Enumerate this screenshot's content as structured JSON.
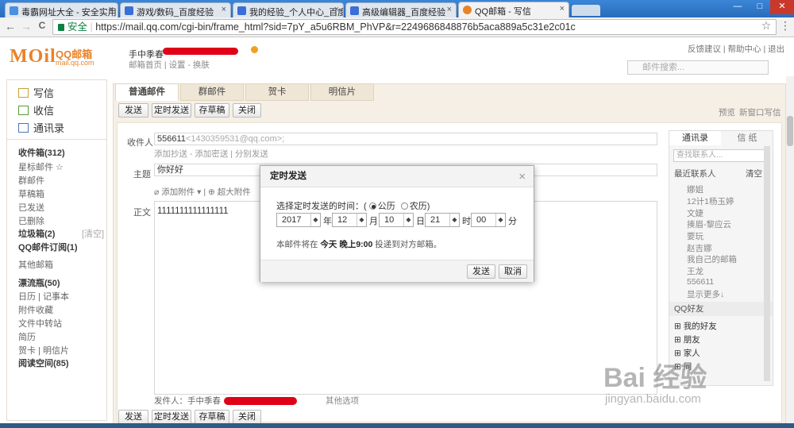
{
  "browser": {
    "tabs": [
      {
        "label": "毒霸网址大全 - 安全实用",
        "fav": "#4a8fe0"
      },
      {
        "label": "游戏/数码_百度经验",
        "fav": "#3b6fd8"
      },
      {
        "label": "我的经验_个人中心_百度",
        "fav": "#3b6fd8"
      },
      {
        "label": "高级编辑器_百度经验",
        "fav": "#3b6fd8"
      },
      {
        "label": "QQ邮箱 - 写信",
        "fav": "#e8832a"
      }
    ],
    "secure_label": "安全",
    "url": "https://mail.qq.com/cgi-bin/frame_html?sid=7pY_a5u6RBM_PhVP&r=2249686848876b5aca889a5c31e2c01c",
    "tab_close": "×",
    "minimize": "—",
    "maximize": "□",
    "close": "✕",
    "back": "←",
    "forward": "→",
    "reload": "C",
    "star": "☆",
    "menu": "⋮"
  },
  "mail": {
    "logo_mark": "MOil",
    "logo_title": "QQ邮箱",
    "logo_domain": "mail.qq.com",
    "user_name": "手中季春",
    "home_link": "邮箱首页",
    "settings_link": "设置",
    "skin_link": "换肤",
    "top_links": [
      "反馈建议",
      "帮助中心",
      "退出"
    ],
    "search_placeholder": "邮件搜索..."
  },
  "sidebar": {
    "write": "写信",
    "inbox": "收信",
    "contacts": "通讯录",
    "folders": [
      {
        "label": "收件箱(312)",
        "bold": true
      },
      {
        "label": "星标邮件 ☆",
        "bold": false
      },
      {
        "label": "群邮件",
        "bold": false
      },
      {
        "label": "草稿箱",
        "bold": false
      },
      {
        "label": "已发送",
        "bold": false
      },
      {
        "label": "已删除",
        "bold": false
      },
      {
        "label": "垃圾箱(2)",
        "bold": true
      },
      {
        "label": "QQ邮件订阅(1)",
        "bold": true
      },
      {
        "label": "其他邮箱",
        "bold": false
      },
      {
        "label": "漂流瓶(50)",
        "bold": true
      },
      {
        "label": "日历 | 记事本",
        "bold": false
      },
      {
        "label": "附件收藏",
        "bold": false
      },
      {
        "label": "文件中转站",
        "bold": false
      },
      {
        "label": "简历",
        "bold": false
      },
      {
        "label": "贺卡 | 明信片",
        "bold": false
      },
      {
        "label": "阅读空间(85)",
        "bold": true
      }
    ],
    "clear": "[清空]"
  },
  "compose": {
    "tabs": [
      "普通邮件",
      "群邮件",
      "贺卡",
      "明信片"
    ],
    "buttons": [
      "发送",
      "定时发送",
      "存草稿",
      "关闭"
    ],
    "preview": "预览",
    "new_window": "新窗口写信",
    "to_label": "收件人",
    "to_value": "556611",
    "to_email": "<1430359531@qq.com>;",
    "cc_links": [
      "添加抄送",
      "添加密送",
      "分别发送"
    ],
    "subject_label": "主题",
    "subject_value": "你好好",
    "attach": "添加附件",
    "big_attach": "超大附件",
    "body_label": "正文",
    "body_value": "1111111111111111",
    "sender_label": "发件人：",
    "sender_name": "手中季春",
    "other_options": "其他选项"
  },
  "rightpanel": {
    "tabs": [
      "通讯录",
      "信 纸"
    ],
    "search_placeholder": "查找联系人...",
    "recent_label": "最近联系人",
    "clear": "清空",
    "contacts": [
      "娜姐",
      "12计1杨玉婷",
      "文婕",
      "揍眉-黎应云",
      "要玩",
      "赵吉娜",
      "我自己的邮箱",
      "王龙",
      "556611",
      "显示更多↓"
    ],
    "qq_label": "QQ好友",
    "groups": [
      "我的好友",
      "朋友",
      "家人",
      "同"
    ]
  },
  "dialog": {
    "title": "定时发送",
    "close": "×",
    "prompt": "选择定时发送的时间：(",
    "solar": "公历",
    "lunar": "农历)",
    "year": "2017",
    "year_unit": "年",
    "month": "12",
    "month_unit": "月",
    "day": "10",
    "day_unit": "日",
    "hour": "21",
    "hour_unit": "时",
    "minute": "00",
    "minute_unit": "分",
    "note_prefix": "本邮件将在",
    "note_time": "今天 晚上9:00",
    "note_suffix": "投递到对方邮箱。",
    "send": "发送",
    "cancel": "取消"
  },
  "watermark": {
    "logo": "Bai 经验",
    "url": "jingyan.baidu.com"
  }
}
